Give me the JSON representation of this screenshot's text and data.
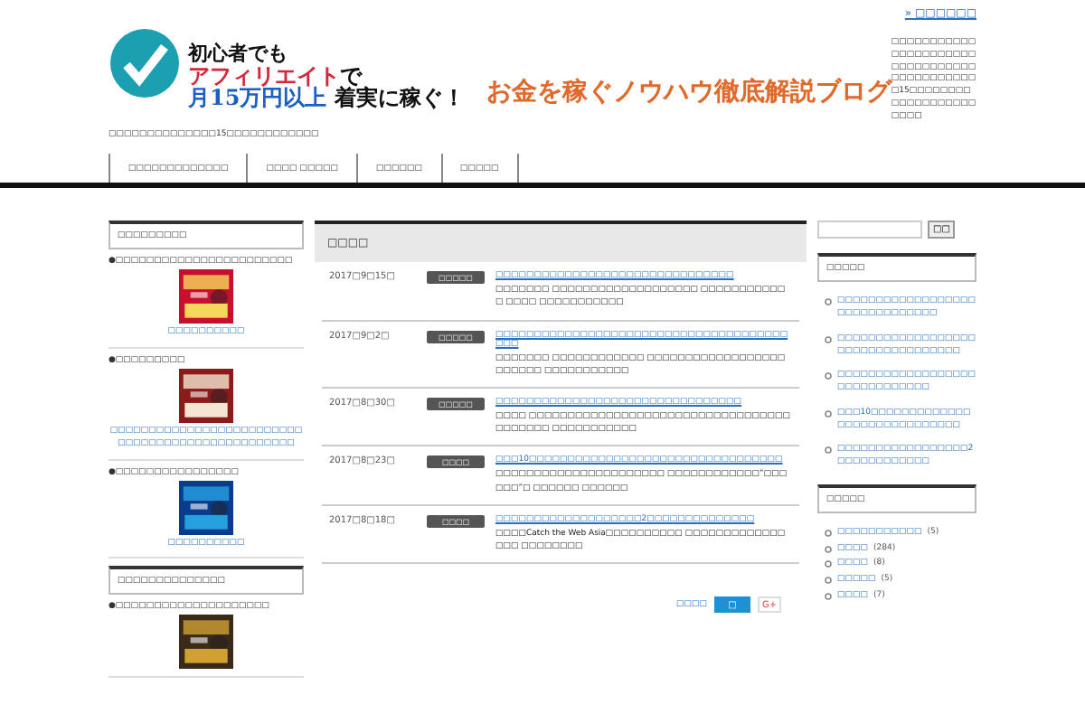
{
  "top_link_marker": "»",
  "top_link": "□□□□□□",
  "site_description": "□□□□□□□□□□□□□□□□□□□□□□□□□□□□□□□□□□□□□□□□□□□□□15□□□□□□□□□□□□□□□□□□□□□□□",
  "banner": {
    "line1": "初心者でも",
    "line2a": "アフィリエイト",
    "line2b": "で",
    "line3a": "月15万円以上",
    "line3b": "着実に稼ぐ！",
    "blog_name": "お金を稼ぐノウハウ徹底解説ブログ"
  },
  "tagline": "□□□□□□□□□□□□□□15□□□□□□□□□□□□",
  "nav": [
    "□□□□□□□□□□□□□",
    "□□□□ □□□□□",
    "□□□□□□",
    "□□□□□"
  ],
  "left_widgets": [
    {
      "title": "□□□□□□□□□",
      "items": [
        {
          "heading": "●□□□□□□□□□□□□□□□□□□□□□□□",
          "link": "□□□□□□□□□□"
        },
        {
          "heading": "●□□□□□□□□□",
          "link": "□□□□□□□□□□□□□□□□□□□□□□□□□□□□□□□□□□□□□□□□□□□□□□□□"
        },
        {
          "heading": "●□□□□□□□□□□□□□□□□",
          "link": "□□□□□□□□□□"
        }
      ]
    },
    {
      "title": "□□□□□□□□□□□□□□",
      "items": [
        {
          "heading": "●□□□□□□□□□□□□□□□□□□□□"
        }
      ]
    }
  ],
  "main": {
    "title": "□□□□",
    "posts": [
      {
        "date": "2017□9□15□",
        "category": "□□□□□",
        "title": "□□□□□□□□□□□□□□□□□□□□□□□□□□□□□□□",
        "excerpt": "□□□□□□□ □□□□□□□□□□□□□□□□□□□ □□□□□□□□□□□□ □□□□ □□□□□□□□□□□"
      },
      {
        "date": "2017□9□2□",
        "category": "□□□□□",
        "title": "□□□□□□□□□□□□□□□□□□□□□□□□□□□□□□□□□□□□□□□□□",
        "excerpt": "□□□□□□□ □□□□□□□□□□□□ □□□□□□□□□□□□□□□□□□□□□□□□ □□□□□□□□□□□"
      },
      {
        "date": "2017□8□30□",
        "category": "□□□□□",
        "title": "□□□□□□□□□□□□□□□□□□□□□□□□□□□□□□□□",
        "excerpt": "□□□□ □□□□□□□□□□□□□□□□□□□□□□□□□□□□□□□□□□ □□□□□□□ □□□□□□□□□□□"
      },
      {
        "date": "2017□8□23□",
        "category": "□□□□",
        "title": "□□□10□□□□□□□□□□□□□□□□□□□□□□□□□□□□□□□□□",
        "excerpt": "□□□□□□□□□□□□□□□□□□□□□□ □□□□□□□□□□□□“□□□□□□”□ □□□□□□ □□□□□□"
      },
      {
        "date": "2017□8□18□",
        "category": "□□□□",
        "title": "□□□□□□□□□□□□□□□□□□□2□□□□□□□□□□□□□□",
        "excerpt": "□□□□Catch the Web Asia□□□□□□□□□□ □□□□□□□□□□□□□ □□□ □□□□□□□□"
      }
    ],
    "share_label": "□□□□",
    "share_buttons": [
      {
        "kind": "like",
        "label": "□"
      },
      {
        "kind": "gplus",
        "label": "G+"
      }
    ]
  },
  "search": {
    "button": "□□"
  },
  "right_widgets": [
    {
      "title": "□□□□□",
      "kind": "posts",
      "links": [
        "□□□□□□□□□□□□□□□□□□□□□□□□□□□□□□□",
        "□□□□□□□□□□□□□□□□□□□□□□□□□□□□□□□□□□",
        "□□□□□□□□□□□□□□□□□□□□□□□□□□□□□□",
        "□□□10□□□□□□□□□□□□□□□□□□□□□□□□□□□□□",
        "□□□□□□□□□□□□□□□□□2□□□□□□□□□□□□"
      ]
    },
    {
      "title": "□□□□□",
      "kind": "categories",
      "links": [
        {
          "name": "□□□□□□□□□□□",
          "count": "(5)"
        },
        {
          "name": "□□□□",
          "count": "(284)"
        },
        {
          "name": "□□□□",
          "count": "(8)"
        },
        {
          "name": "□□□□□",
          "count": "(5)"
        },
        {
          "name": "□□□□",
          "count": "(7)"
        }
      ]
    }
  ]
}
